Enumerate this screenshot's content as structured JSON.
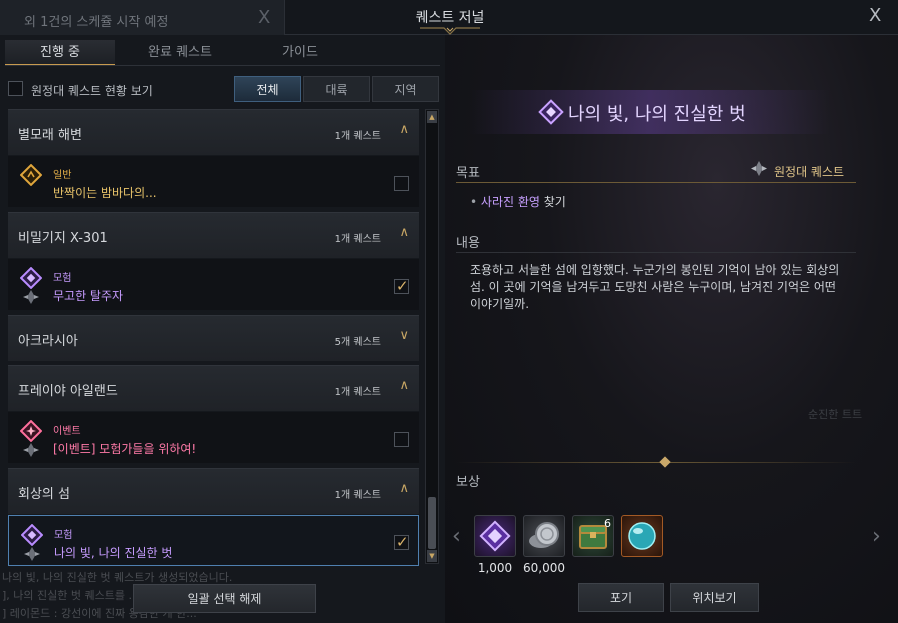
{
  "notice": {
    "text": "외 1건의 스케쥴 시작 예정",
    "close": "X"
  },
  "window": {
    "title": "퀘스트 저널",
    "close": "X"
  },
  "tabs": [
    {
      "label": "진행 중",
      "active": true
    },
    {
      "label": "완료 퀘스트",
      "active": false
    },
    {
      "label": "가이드",
      "active": false
    }
  ],
  "expedition_toggle": {
    "label": "원정대 퀘스트 현황 보기",
    "checked": false
  },
  "filters": [
    {
      "label": "전체",
      "active": true
    },
    {
      "label": "대륙",
      "active": false
    },
    {
      "label": "지역",
      "active": false
    }
  ],
  "regions": [
    {
      "name": "별모래 해변",
      "count": "1개 퀘스트",
      "expanded": true,
      "quests": [
        {
          "type": "일반",
          "name": "반짝이는 밤바다의...",
          "checked": false,
          "icon": "normal-quest-icon",
          "type_color": "#e8b34a",
          "name_color": "#e8c36a"
        }
      ]
    },
    {
      "name": "비밀기지 X-301",
      "count": "1개 퀘스트",
      "expanded": true,
      "quests": [
        {
          "type": "모험",
          "name": "무고한 탈주자",
          "checked": true,
          "icon": "adventure-quest-icon",
          "type_color": "#c79cff",
          "name_color": "#c79cff"
        }
      ]
    },
    {
      "name": "아크라시아",
      "count": "5개 퀘스트",
      "expanded": false,
      "quests": []
    },
    {
      "name": "프레이야 아일랜드",
      "count": "1개 퀘스트",
      "expanded": true,
      "quests": [
        {
          "type": "이벤트",
          "name": "[이벤트] 모험가들을 위하여!",
          "checked": false,
          "icon": "event-quest-icon",
          "type_color": "#ff7aa8",
          "name_color": "#ff7aa8"
        }
      ]
    },
    {
      "name": "회상의 섬",
      "count": "1개 퀘스트",
      "expanded": true,
      "quests": [
        {
          "type": "모험",
          "name": "나의 빛, 나의 진실한 벗",
          "checked": true,
          "icon": "adventure-quest-icon",
          "type_color": "#c79cff",
          "name_color": "#c79cff",
          "selected": true
        }
      ]
    }
  ],
  "chat_lines": [
    "나의 빛, 나의 진실한 벗 퀘스트가 생성되었습니다.",
    "], 나의 진실한 벗 퀘스트를 ...",
    "] 레이몬드 : 강선이에 진짜 용감한 게 한..."
  ],
  "deselect_button": "일괄 선택 해제",
  "detail": {
    "title": "나의 빛, 나의 진실한 벗",
    "goal_label": "목표",
    "goal_tag": "원정대 퀘스트",
    "goal_item_highlight": "사라진 환영",
    "goal_item_rest": " 찾기",
    "content_label": "내용",
    "content_text": "조용하고 서늘한 섬에 입항했다. 누군가의 봉인된 기억이 남아 있는 회상의 섬. 이 곳에 기억을 남겨두고 도망친 사람은 누구이며, 남겨진 기억은 어떤 이야기일까.",
    "ghost_text": "순진한 트트",
    "reward_label": "보상",
    "rewards": [
      {
        "icon": "purple-gem-icon",
        "value": "1,000"
      },
      {
        "icon": "silver-coin-icon",
        "value": "60,000"
      },
      {
        "icon": "green-chest-icon",
        "value": "",
        "badge": "6"
      },
      {
        "icon": "cyan-orb-icon",
        "value": ""
      }
    ],
    "abandon_button": "포기",
    "locate_button": "위치보기"
  }
}
